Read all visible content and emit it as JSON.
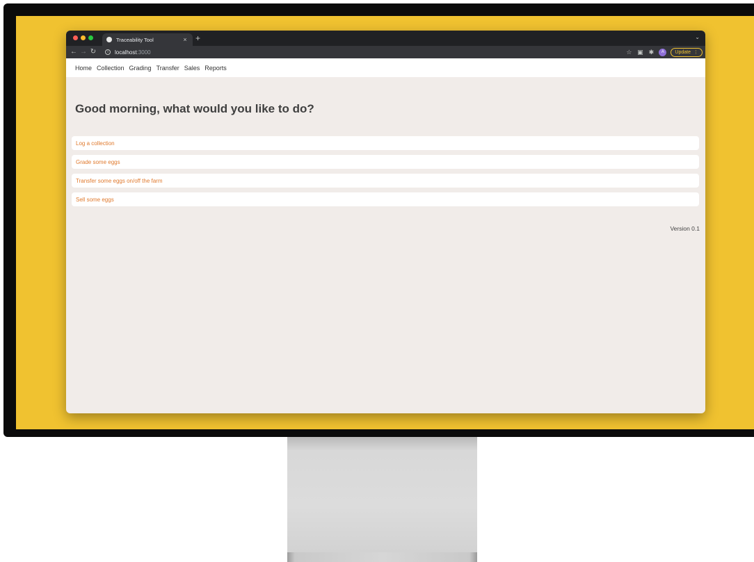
{
  "browser": {
    "tab_title": "Traceability Tool",
    "tab_close": "×",
    "new_tab": "+",
    "url_host": "localhost",
    "url_port": ":3000",
    "update_label": "Update",
    "avatar_initial": "A"
  },
  "nav": {
    "items": [
      "Home",
      "Collection",
      "Grading",
      "Transfer",
      "Sales",
      "Reports"
    ]
  },
  "main": {
    "greeting": "Good morning, what would you like to do?",
    "actions": [
      "Log a collection",
      "Grade some eggs",
      "Transfer some eggs on/off the farm",
      "Sell some eggs"
    ],
    "version": "Version 0.1"
  },
  "colors": {
    "background": "#f0c230",
    "link": "#e07a2e",
    "page_bg": "#f1ece9",
    "avatar": "#8e6fd8"
  },
  "icons": {
    "back": "back-arrow-icon",
    "forward": "forward-arrow-icon",
    "reload": "reload-icon",
    "info": "info-icon",
    "star": "star-icon",
    "extension": "extension-icon",
    "puzzle": "puzzle-icon"
  }
}
